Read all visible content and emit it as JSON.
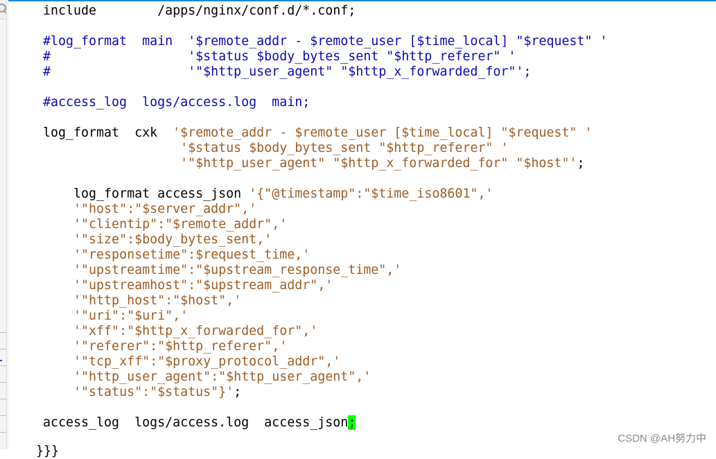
{
  "editor": {
    "lines": [
      {
        "segments": [
          {
            "t": "include        /apps/nginx/conf.d/*.conf;",
            "c": "kw"
          }
        ]
      },
      {
        "segments": []
      },
      {
        "segments": [
          {
            "t": "#log_format  main  '$remote_addr - $remote_user [$time_local] \"$request\" '",
            "c": "cm"
          }
        ]
      },
      {
        "segments": [
          {
            "t": "#                  '$status $body_bytes_sent \"$http_referer\" '",
            "c": "cm"
          }
        ]
      },
      {
        "segments": [
          {
            "t": "#                  '\"$http_user_agent\" \"$http_x_forwarded_for\"';",
            "c": "cm"
          }
        ]
      },
      {
        "segments": []
      },
      {
        "segments": [
          {
            "t": "#access_log  logs/access.log  main;",
            "c": "cm"
          }
        ]
      },
      {
        "segments": []
      },
      {
        "segments": [
          {
            "t": "log_format  cxk  ",
            "c": "kw"
          },
          {
            "t": "'$remote_addr - $remote_user [$time_local] \"$request\" '",
            "c": "str"
          }
        ]
      },
      {
        "segments": [
          {
            "t": "                  ",
            "c": "kw"
          },
          {
            "t": "'$status $body_bytes_sent \"$http_referer\" '",
            "c": "str"
          }
        ]
      },
      {
        "segments": [
          {
            "t": "                  ",
            "c": "kw"
          },
          {
            "t": "'\"$http_user_agent\" \"$http_x_forwarded_for\" \"$host\"'",
            "c": "str"
          },
          {
            "t": ";",
            "c": "kw"
          }
        ]
      },
      {
        "segments": []
      },
      {
        "segments": [
          {
            "t": "    log_format access_json ",
            "c": "kw"
          },
          {
            "t": "'{\"@timestamp\":\"$time_iso8601\",'",
            "c": "str"
          }
        ]
      },
      {
        "segments": [
          {
            "t": "    ",
            "c": "kw"
          },
          {
            "t": "'\"host\":\"$server_addr\",'",
            "c": "str"
          }
        ]
      },
      {
        "segments": [
          {
            "t": "    ",
            "c": "kw"
          },
          {
            "t": "'\"clientip\":\"$remote_addr\",'",
            "c": "str"
          }
        ]
      },
      {
        "segments": [
          {
            "t": "    ",
            "c": "kw"
          },
          {
            "t": "'\"size\":$body_bytes_sent,'",
            "c": "str"
          }
        ]
      },
      {
        "segments": [
          {
            "t": "    ",
            "c": "kw"
          },
          {
            "t": "'\"responsetime\":$request_time,'",
            "c": "str"
          }
        ]
      },
      {
        "segments": [
          {
            "t": "    ",
            "c": "kw"
          },
          {
            "t": "'\"upstreamtime\":\"$upstream_response_time\",'",
            "c": "str"
          }
        ]
      },
      {
        "segments": [
          {
            "t": "    ",
            "c": "kw"
          },
          {
            "t": "'\"upstreamhost\":\"$upstream_addr\",'",
            "c": "str"
          }
        ]
      },
      {
        "segments": [
          {
            "t": "    ",
            "c": "kw"
          },
          {
            "t": "'\"http_host\":\"$host\",'",
            "c": "str"
          }
        ]
      },
      {
        "segments": [
          {
            "t": "    ",
            "c": "kw"
          },
          {
            "t": "'\"uri\":\"$uri\",'",
            "c": "str"
          }
        ]
      },
      {
        "segments": [
          {
            "t": "    ",
            "c": "kw"
          },
          {
            "t": "'\"xff\":\"$http_x_forwarded_for\",'",
            "c": "str"
          }
        ]
      },
      {
        "segments": [
          {
            "t": "    ",
            "c": "kw"
          },
          {
            "t": "'\"referer\":\"$http_referer\",'",
            "c": "str"
          }
        ]
      },
      {
        "segments": [
          {
            "t": "    ",
            "c": "kw"
          },
          {
            "t": "'\"tcp_xff\":\"$proxy_protocol_addr\",'",
            "c": "str"
          }
        ]
      },
      {
        "segments": [
          {
            "t": "    ",
            "c": "kw"
          },
          {
            "t": "'\"http_user_agent\":\"$http_user_agent\",'",
            "c": "str"
          }
        ]
      },
      {
        "segments": [
          {
            "t": "    ",
            "c": "kw"
          },
          {
            "t": "'\"status\":\"$status\"}'",
            "c": "str"
          },
          {
            "t": ";",
            "c": "kw"
          }
        ]
      },
      {
        "segments": []
      },
      {
        "segments": [
          {
            "t": "access_log  logs/access.log  access_json",
            "c": "kw"
          },
          {
            "t": ";",
            "c": "cursor"
          }
        ]
      }
    ],
    "clipped_bottom_line": "}}}"
  },
  "colors": {
    "comment": "#0a0ab0",
    "string": "#9e5c24",
    "cursor": "#00ff00",
    "accent": "#1a86d8"
  },
  "watermark": "CSDN @AH努力中"
}
